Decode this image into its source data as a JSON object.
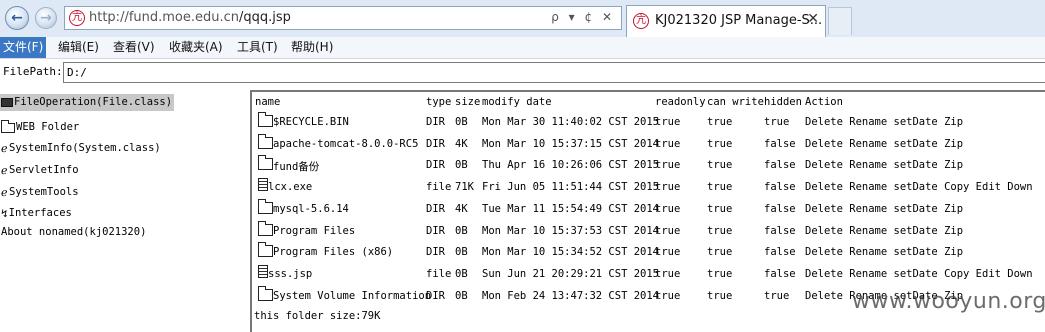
{
  "browser": {
    "url_host": "http://fund.moe.edu.cn",
    "url_path": "/qqq.jsp",
    "address_tools": "ρ ▾ ¢ ✕",
    "tab_title": "KJ021320 JSP Manage-S...",
    "tab_close": "✕",
    "site_icon_glyph": "亢"
  },
  "menu": [
    "文件(F)",
    "编辑(E)",
    "查看(V)",
    "收藏夹(A)",
    "工具(T)",
    "帮助(H)"
  ],
  "filepath": {
    "label": "FilePath:",
    "value": "D:/"
  },
  "nav": [
    {
      "label": "FileOperation(File.class)",
      "icon": "computer-icon",
      "selected": true
    },
    {
      "label": "WEB Folder",
      "icon": "folder-icon",
      "selected": false
    },
    {
      "label": "SystemInfo(System.class)",
      "icon": "plug-icon",
      "selected": false
    },
    {
      "label": "ServletInfo",
      "icon": "plug-icon",
      "selected": false
    },
    {
      "label": "SystemTools",
      "icon": "plug-icon",
      "selected": false
    },
    {
      "label": "Interfaces",
      "icon": "interface-icon",
      "selected": false
    },
    {
      "label": "About nonamed(kj021320)",
      "icon": "",
      "selected": false
    }
  ],
  "table": {
    "headers": [
      "name",
      "type",
      "size",
      "modify date",
      "readonly",
      "can write",
      "hidden",
      "Action"
    ],
    "rows": [
      {
        "name": "$RECYCLE.BIN",
        "type": "DIR",
        "size": "0B",
        "date": "Mon Mar 30 11:40:02 CST 2015",
        "readonly": "true",
        "canwrite": "true",
        "hidden": "true",
        "actions": "Delete Rename setDate Zip",
        "is_dir": true
      },
      {
        "name": "apache-tomcat-8.0.0-RC5",
        "type": "DIR",
        "size": "4K",
        "date": "Mon Mar 10 15:37:15 CST 2014",
        "readonly": "true",
        "canwrite": "true",
        "hidden": "false",
        "actions": "Delete Rename setDate Zip",
        "is_dir": true
      },
      {
        "name": "fund备份",
        "type": "DIR",
        "size": "0B",
        "date": "Thu Apr 16 10:26:06 CST 2015",
        "readonly": "true",
        "canwrite": "true",
        "hidden": "false",
        "actions": "Delete Rename setDate Zip",
        "is_dir": true
      },
      {
        "name": "lcx.exe",
        "type": "file",
        "size": "71K",
        "date": "Fri Jun 05 11:51:44 CST 2015",
        "readonly": "true",
        "canwrite": "true",
        "hidden": "false",
        "actions": "Delete Rename setDate Copy Edit Down",
        "is_dir": false
      },
      {
        "name": "mysql-5.6.14",
        "type": "DIR",
        "size": "4K",
        "date": "Tue Mar 11 15:54:49 CST 2014",
        "readonly": "true",
        "canwrite": "true",
        "hidden": "false",
        "actions": "Delete Rename setDate Zip",
        "is_dir": true
      },
      {
        "name": "Program Files",
        "type": "DIR",
        "size": "0B",
        "date": "Mon Mar 10 15:37:53 CST 2014",
        "readonly": "true",
        "canwrite": "true",
        "hidden": "false",
        "actions": "Delete Rename setDate Zip",
        "is_dir": true
      },
      {
        "name": "Program Files (x86)",
        "type": "DIR",
        "size": "0B",
        "date": "Mon Mar 10 15:34:52 CST 2014",
        "readonly": "true",
        "canwrite": "true",
        "hidden": "false",
        "actions": "Delete Rename setDate Zip",
        "is_dir": true
      },
      {
        "name": "sss.jsp",
        "type": "file",
        "size": "0B",
        "date": "Sun Jun 21 20:29:21 CST 2015",
        "readonly": "true",
        "canwrite": "true",
        "hidden": "false",
        "actions": "Delete Rename setDate Copy Edit Down",
        "is_dir": false
      },
      {
        "name": "System Volume Information",
        "type": "DIR",
        "size": "0B",
        "date": "Mon Feb 24 13:47:32 CST 2014",
        "readonly": "true",
        "canwrite": "true",
        "hidden": "true",
        "actions": "Delete Rename setDate Zip",
        "is_dir": true
      }
    ],
    "footer": "this folder size:79K"
  },
  "watermark": "www.wooyun.org"
}
